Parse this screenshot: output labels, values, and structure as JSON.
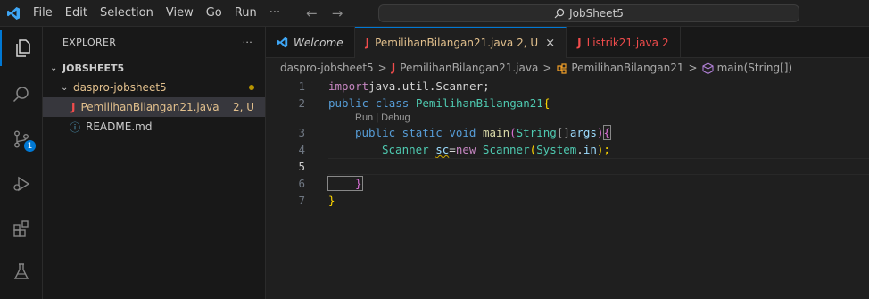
{
  "menu": {
    "items": [
      "File",
      "Edit",
      "Selection",
      "View",
      "Go",
      "Run"
    ],
    "more": "···"
  },
  "nav": {
    "back": "←",
    "forward": "→"
  },
  "command_center": {
    "text": "JobSheet5"
  },
  "activity_bar": {
    "scm_badge": "1"
  },
  "sidebar": {
    "title": "EXPLORER",
    "more": "···",
    "root": "JOBSHEET5",
    "folder": "daspro-jobsheet5",
    "files": [
      {
        "name": "PemilihanBilangan21.java",
        "icon": "J",
        "status": "2, U"
      },
      {
        "name": "README.md",
        "icon": "ⓘ",
        "status": ""
      }
    ]
  },
  "tabs": [
    {
      "label": "Welcome",
      "icon": "vscode-logo"
    },
    {
      "label": "PemilihanBilangan21.java",
      "icon": "J",
      "suffix": "2, U",
      "close": "×"
    },
    {
      "label": "Listrik21.java",
      "icon": "J",
      "suffix": "2"
    }
  ],
  "breadcrumb": {
    "folder": "daspro-jobsheet5",
    "file_icon": "J",
    "file": "PemilihanBilangan21.java",
    "class": "PemilihanBilangan21",
    "method": "main(String[])",
    "sep": ">"
  },
  "code": {
    "line_numbers": [
      "1",
      "2",
      "3",
      "4",
      "5",
      "6",
      "7"
    ],
    "codelens": "Run | Debug",
    "line1": {
      "kw": "import",
      "rest": " java.util.Scanner;"
    },
    "line2": {
      "kw": "public class",
      "name": "PemilihanBilangan21",
      "brace": " {"
    },
    "line3": {
      "kw": "public static void",
      "fn": "main",
      "p1": "(",
      "ty": "String",
      "p2": "[] ",
      "var": "args",
      "p3": ") ",
      "brace": "{"
    },
    "line4": {
      "ty": "Scanner",
      "var": "sc",
      "eq": " = ",
      "kw": "new",
      "ty2": "Scanner",
      "p1": "(",
      "ty3": "System",
      "dot": ".",
      "var2": "in",
      "p2": ");"
    },
    "line6": {
      "brace": "}"
    },
    "line7": {
      "brace": "}"
    }
  },
  "colors": {
    "accent": "#0078d4",
    "modified": "#e2c08d",
    "error_file": "#f14c4c"
  }
}
